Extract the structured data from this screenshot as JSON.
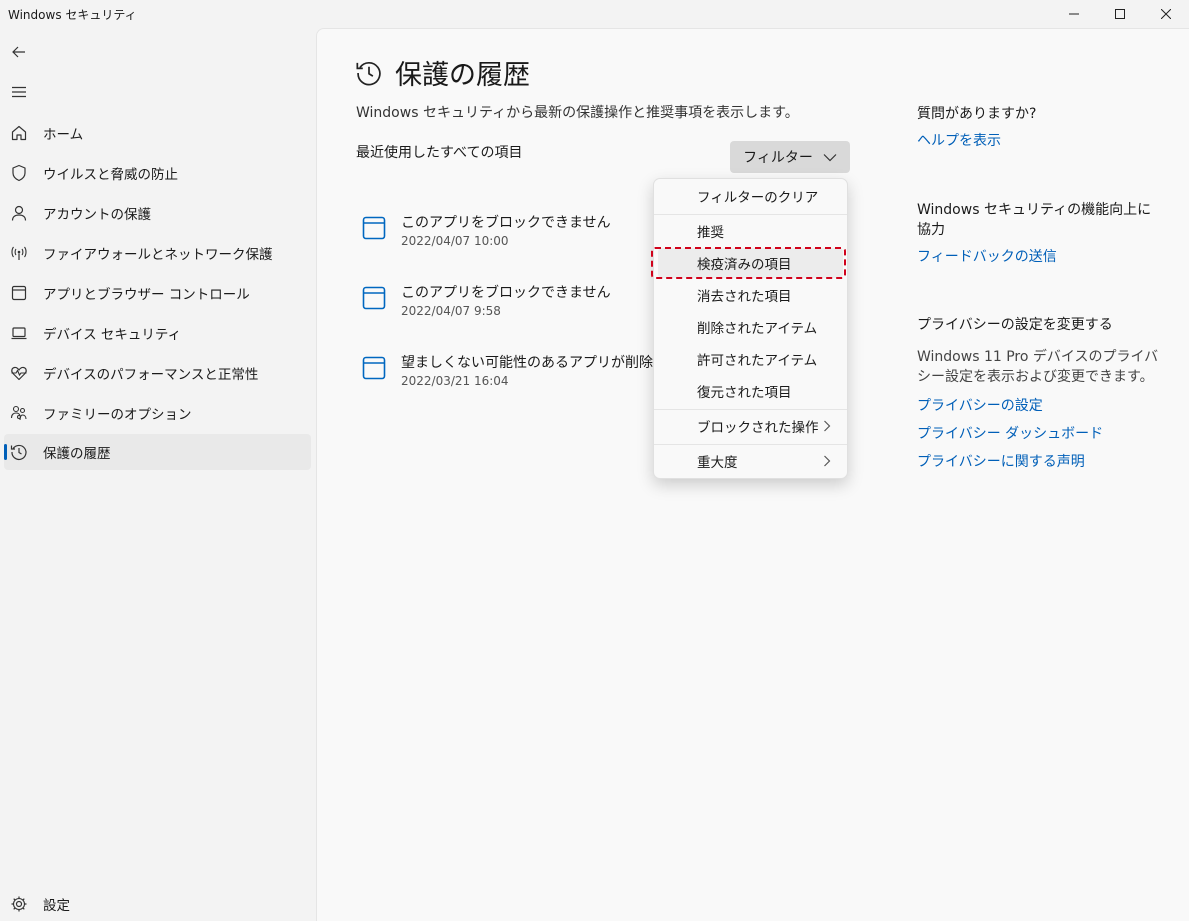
{
  "window": {
    "title": "Windows セキュリティ"
  },
  "sidebar": {
    "items": [
      {
        "label": "ホーム",
        "icon": "home-icon"
      },
      {
        "label": "ウイルスと脅威の防止",
        "icon": "shield-icon"
      },
      {
        "label": "アカウントの保護",
        "icon": "person-icon"
      },
      {
        "label": "ファイアウォールとネットワーク保護",
        "icon": "wifi-antenna-icon"
      },
      {
        "label": "アプリとブラウザー コントロール",
        "icon": "browser-window-icon"
      },
      {
        "label": "デバイス セキュリティ",
        "icon": "laptop-icon"
      },
      {
        "label": "デバイスのパフォーマンスと正常性",
        "icon": "heart-pulse-icon"
      },
      {
        "label": "ファミリーのオプション",
        "icon": "family-icon"
      },
      {
        "label": "保護の履歴",
        "icon": "history-icon",
        "selected": true
      }
    ],
    "settings_label": "設定"
  },
  "main": {
    "title": "保護の履歴",
    "subtitle": "Windows セキュリティから最新の保護操作と推奨事項を表示します。",
    "recent_label": "最近使用したすべての項目",
    "filter_label": "フィルター",
    "history": [
      {
        "title": "このアプリをブロックできません",
        "date": "2022/04/07 10:00"
      },
      {
        "title": "このアプリをブロックできません",
        "date": "2022/04/07 9:58"
      },
      {
        "title": "望ましくない可能性のあるアプリが削除され",
        "date": "2022/03/21 16:04"
      }
    ]
  },
  "right": {
    "question_heading": "質問がありますか?",
    "help_link": "ヘルプを表示",
    "improve_heading": "Windows セキュリティの機能向上に協力",
    "feedback_link": "フィードバックの送信",
    "privacy_heading": "プライバシーの設定を変更する",
    "privacy_text": "Windows 11 Pro デバイスのプライバシー設定を表示および変更できます。",
    "privacy_links": [
      "プライバシーの設定",
      "プライバシー ダッシュボード",
      "プライバシーに関する声明"
    ]
  },
  "filter_menu": {
    "clear": "フィルターのクリア",
    "items": [
      "推奨",
      "検疫済みの項目",
      "消去された項目",
      "削除されたアイテム",
      "許可されたアイテム",
      "復元された項目"
    ],
    "blocked": "ブロックされた操作",
    "severity": "重大度",
    "highlighted_item": "検疫済みの項目"
  },
  "colors": {
    "accent": "#005fb8",
    "highlight_border": "#d0021b"
  }
}
